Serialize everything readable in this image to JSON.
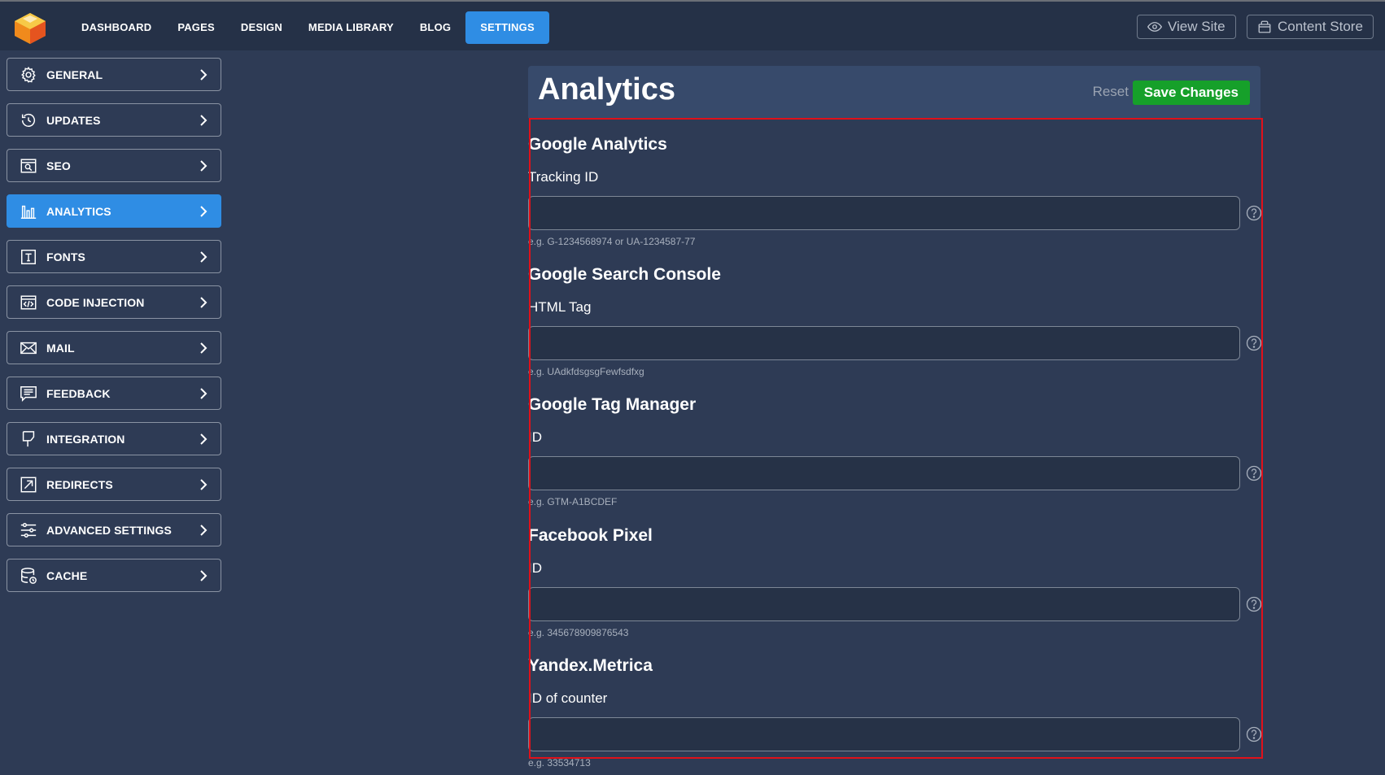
{
  "topbar": {
    "nav": [
      "DASHBOARD",
      "PAGES",
      "DESIGN",
      "MEDIA LIBRARY",
      "BLOG",
      "SETTINGS"
    ],
    "active_nav": "SETTINGS",
    "view_site": "View Site",
    "content_store": "Content Store"
  },
  "sidebar": {
    "items": [
      {
        "label": "GENERAL",
        "icon": "gear-icon"
      },
      {
        "label": "UPDATES",
        "icon": "history-icon"
      },
      {
        "label": "SEO",
        "icon": "seo-icon"
      },
      {
        "label": "ANALYTICS",
        "icon": "bar-chart-icon",
        "active": true
      },
      {
        "label": "FONTS",
        "icon": "font-icon"
      },
      {
        "label": "CODE INJECTION",
        "icon": "code-icon"
      },
      {
        "label": "MAIL",
        "icon": "mail-icon"
      },
      {
        "label": "FEEDBACK",
        "icon": "feedback-icon"
      },
      {
        "label": "INTEGRATION",
        "icon": "integration-icon"
      },
      {
        "label": "REDIRECTS",
        "icon": "redirect-icon"
      },
      {
        "label": "ADVANCED SETTINGS",
        "icon": "sliders-icon"
      },
      {
        "label": "CACHE",
        "icon": "database-icon"
      }
    ]
  },
  "panel": {
    "title": "Analytics",
    "reset": "Reset",
    "save": "Save Changes"
  },
  "sections": [
    {
      "title": "Google Analytics",
      "label": "Tracking ID",
      "value": "",
      "hint": "e.g. G-1234568974 or UA-1234587-77"
    },
    {
      "title": "Google Search Console",
      "label": "HTML Tag",
      "value": "",
      "hint": "e.g. UAdkfdsgsgFewfsdfxg"
    },
    {
      "title": "Google Tag Manager",
      "label": "ID",
      "value": "",
      "hint": "e.g. GTM-A1BCDEF"
    },
    {
      "title": "Facebook Pixel",
      "label": "ID",
      "value": "",
      "hint": "e.g. 345678909876543"
    },
    {
      "title": "Yandex.Metrica",
      "label": "ID of counter",
      "value": "",
      "hint": "e.g. 33534713"
    }
  ],
  "colors": {
    "background": "#2e3b55",
    "topbar": "#253147",
    "accent": "#2f8de4",
    "save": "#16a02a",
    "highlight": "#e0111a"
  }
}
